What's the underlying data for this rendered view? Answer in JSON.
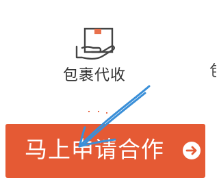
{
  "service": {
    "icon": "package-hand-icon",
    "label": "包裹代收"
  },
  "next_item": {
    "label_fragment": "包"
  },
  "apply_button": {
    "label": "马上申请合作",
    "icon": "arrow-right-circle-icon"
  },
  "colors": {
    "button": "#e55a34",
    "button_text": "#ffffff",
    "label_text": "#333333",
    "scribble": "#3a8fd8"
  }
}
